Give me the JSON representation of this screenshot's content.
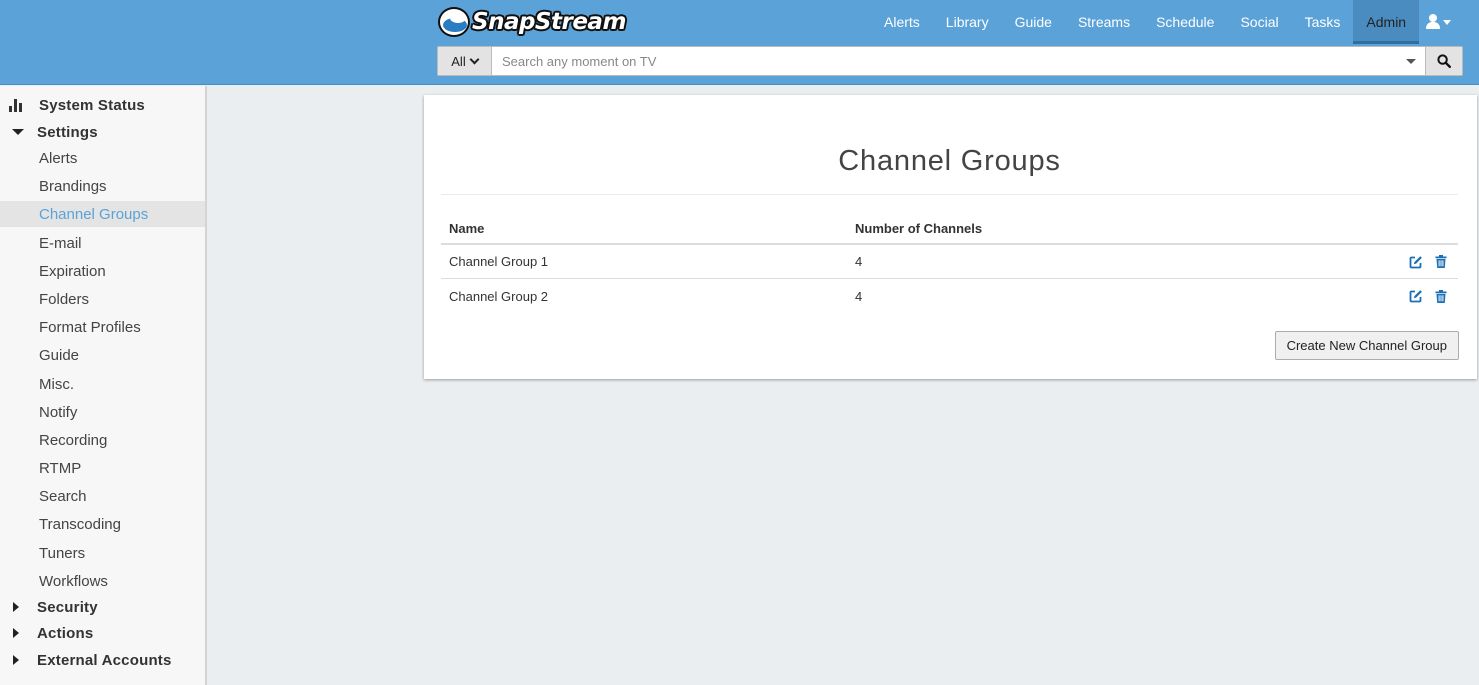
{
  "brand": {
    "name": "SnapStream"
  },
  "nav": {
    "items": [
      {
        "label": "Alerts",
        "active": false
      },
      {
        "label": "Library",
        "active": false
      },
      {
        "label": "Guide",
        "active": false
      },
      {
        "label": "Streams",
        "active": false
      },
      {
        "label": "Schedule",
        "active": false
      },
      {
        "label": "Social",
        "active": false
      },
      {
        "label": "Tasks",
        "active": false
      },
      {
        "label": "Admin",
        "active": true
      }
    ],
    "user_icon": "user-icon"
  },
  "search": {
    "scope": "All",
    "placeholder": "Search any moment on TV",
    "value": "",
    "button_icon": "search-icon"
  },
  "sidebar": {
    "system_status": "System Status",
    "settings": {
      "label": "Settings",
      "expanded": true,
      "items": [
        "Alerts",
        "Brandings",
        "Channel Groups",
        "E-mail",
        "Expiration",
        "Folders",
        "Format Profiles",
        "Guide",
        "Misc.",
        "Notify",
        "Recording",
        "RTMP",
        "Search",
        "Transcoding",
        "Tuners",
        "Workflows"
      ],
      "active": "Channel Groups"
    },
    "security": "Security",
    "actions": "Actions",
    "external_accounts": "External Accounts"
  },
  "main": {
    "title": "Channel Groups",
    "table": {
      "headers": {
        "name": "Name",
        "count": "Number of Channels"
      },
      "rows": [
        {
          "name": "Channel Group 1",
          "count": "4"
        },
        {
          "name": "Channel Group 2",
          "count": "4"
        }
      ]
    },
    "create_label": "Create New Channel Group"
  },
  "colors": {
    "header_bg": "#5aa2d8",
    "active_tab_bg": "#4a8cc0",
    "link_active": "#5aa2d8",
    "icon_blue": "#1a6fb5",
    "page_bg": "#ebeef1"
  }
}
